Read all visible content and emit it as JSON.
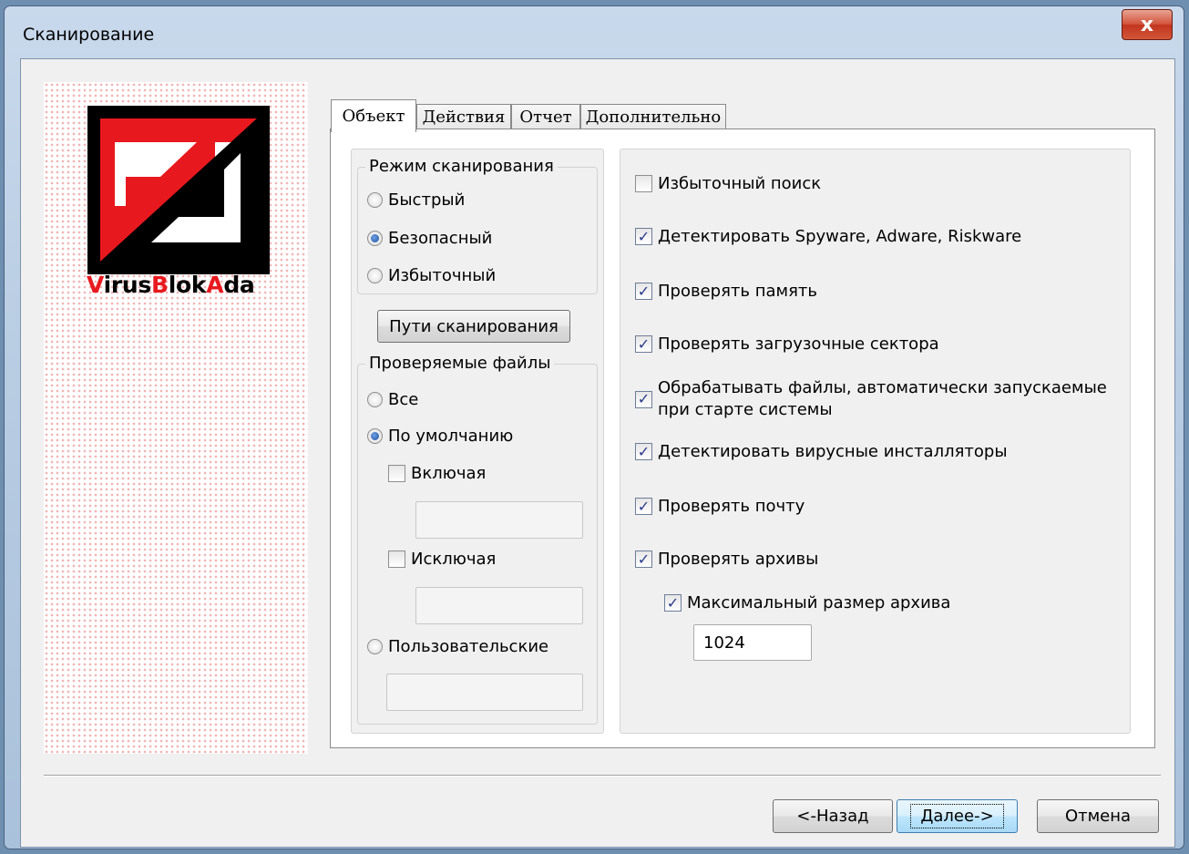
{
  "window": {
    "title": "Сканирование",
    "close_glyph": "x"
  },
  "logo": {
    "brand_parts": [
      "V",
      "irus",
      "B",
      "lok",
      "A",
      "da"
    ],
    "colors": {
      "red": "#e8191e",
      "black": "#000000"
    }
  },
  "tabs": [
    {
      "label": "Объект",
      "active": true
    },
    {
      "label": "Действия",
      "active": false
    },
    {
      "label": "Отчет",
      "active": false
    },
    {
      "label": "Дополнительно",
      "active": false
    }
  ],
  "scan_mode": {
    "title": "Режим сканирования",
    "options": [
      {
        "label": "Быстрый",
        "selected": false
      },
      {
        "label": "Безопасный",
        "selected": true
      },
      {
        "label": "Избыточный",
        "selected": false
      }
    ]
  },
  "scan_paths_button": "Пути сканирования",
  "files": {
    "title": "Проверяемые файлы",
    "all": {
      "label": "Все",
      "selected": false
    },
    "default": {
      "label": "По умолчанию",
      "selected": true
    },
    "including": {
      "label": "Включая",
      "checked": false,
      "value": ""
    },
    "excluding": {
      "label": "Исключая",
      "checked": false,
      "value": ""
    },
    "custom": {
      "label": "Пользовательские",
      "selected": false,
      "value": ""
    }
  },
  "options": [
    {
      "label": "Избыточный поиск",
      "checked": false
    },
    {
      "label": "Детектировать Spyware, Adware, Riskware",
      "checked": true
    },
    {
      "label": "Проверять память",
      "checked": true
    },
    {
      "label": "Проверять загрузочные сектора",
      "checked": true
    },
    {
      "label_line1": "Обрабатывать файлы, автоматически запускаемые",
      "label_line2": "при старте системы",
      "checked": true
    },
    {
      "label": "Детектировать вирусные инсталляторы",
      "checked": true
    },
    {
      "label": "Проверять почту",
      "checked": true
    },
    {
      "label": "Проверять архивы",
      "checked": true
    }
  ],
  "archive_max": {
    "label": "Максимальный размер архива",
    "checked": true,
    "value": "1024"
  },
  "buttons": {
    "back": "<-Назад",
    "next": "Далее->",
    "cancel": "Отмена"
  }
}
